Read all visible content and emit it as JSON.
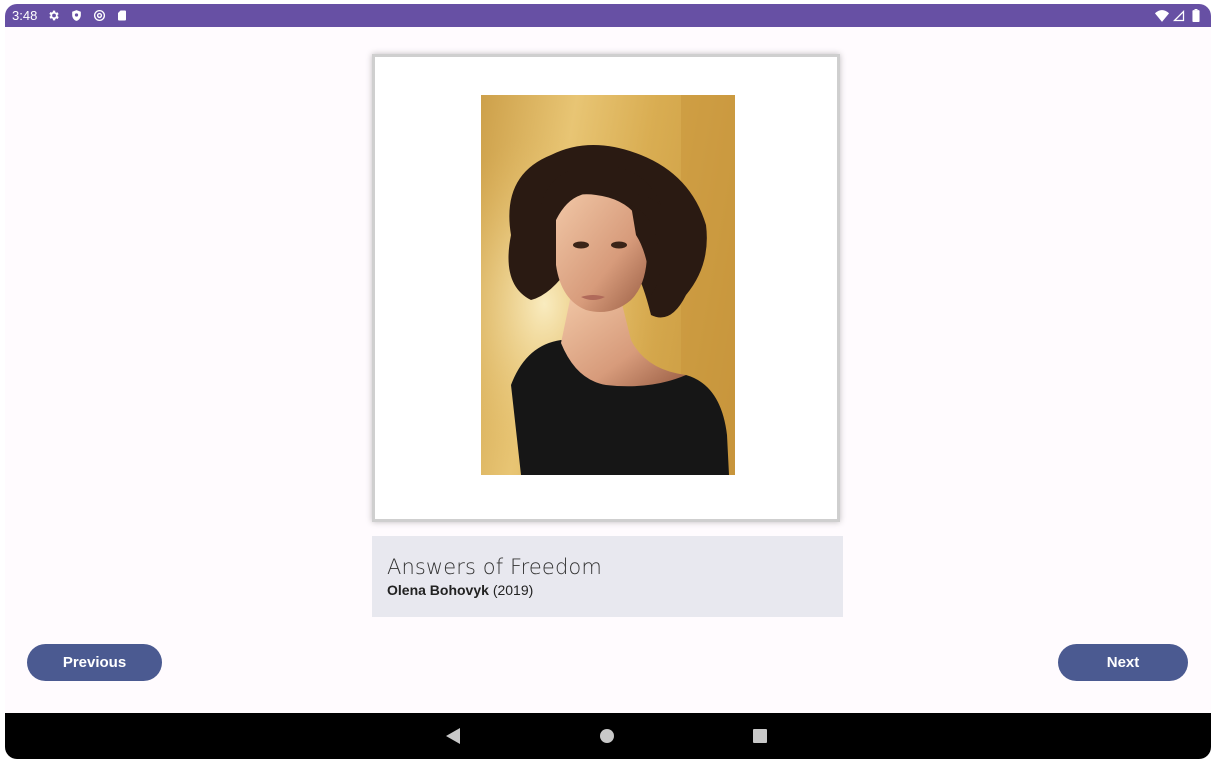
{
  "status_bar": {
    "time": "3:48",
    "left_icons": [
      "gear-icon",
      "shield-icon",
      "vpn-icon",
      "sd-card-icon"
    ],
    "right_icons": [
      "wifi-icon",
      "signal-icon",
      "battery-icon"
    ],
    "color": "#6750a4"
  },
  "artwork": {
    "image": "portrait-photo",
    "title": "Answers of Freedom",
    "artist": "Olena Bohovyk",
    "year": "(2019)"
  },
  "buttons": {
    "previous_label": "Previous",
    "next_label": "Next",
    "color": "#4b5a91"
  },
  "nav_bar": {
    "items": [
      "back-icon",
      "home-icon",
      "recents-icon"
    ]
  }
}
